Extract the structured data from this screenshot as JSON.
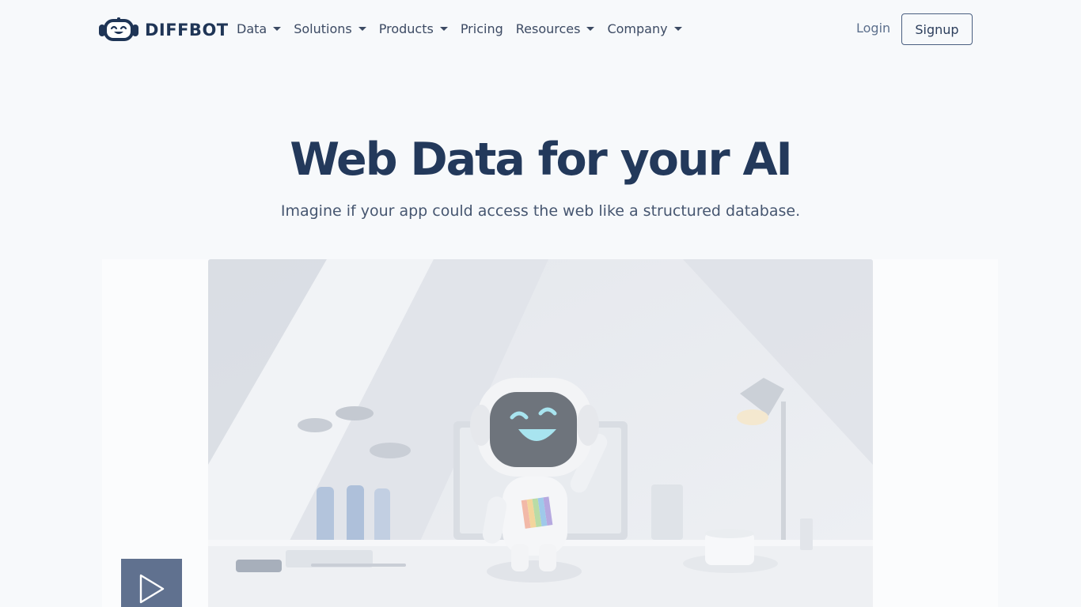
{
  "brand": {
    "name": "DIFFBOT"
  },
  "nav": {
    "items": [
      {
        "label": "Data",
        "dropdown": true
      },
      {
        "label": "Solutions",
        "dropdown": true
      },
      {
        "label": "Products",
        "dropdown": true
      },
      {
        "label": "Pricing",
        "dropdown": false
      },
      {
        "label": "Resources",
        "dropdown": true
      },
      {
        "label": "Company",
        "dropdown": true
      }
    ],
    "login_label": "Login",
    "signup_label": "Signup"
  },
  "hero": {
    "title": "Web Data for your AI",
    "subtitle": "Imagine if your app could access the web like a structured database."
  },
  "video": {
    "play_icon": "play-icon"
  },
  "colors": {
    "background": "#f7f9fb",
    "brand_navy": "#1f3556",
    "title": "#23395b",
    "play_button": "#60718f"
  }
}
